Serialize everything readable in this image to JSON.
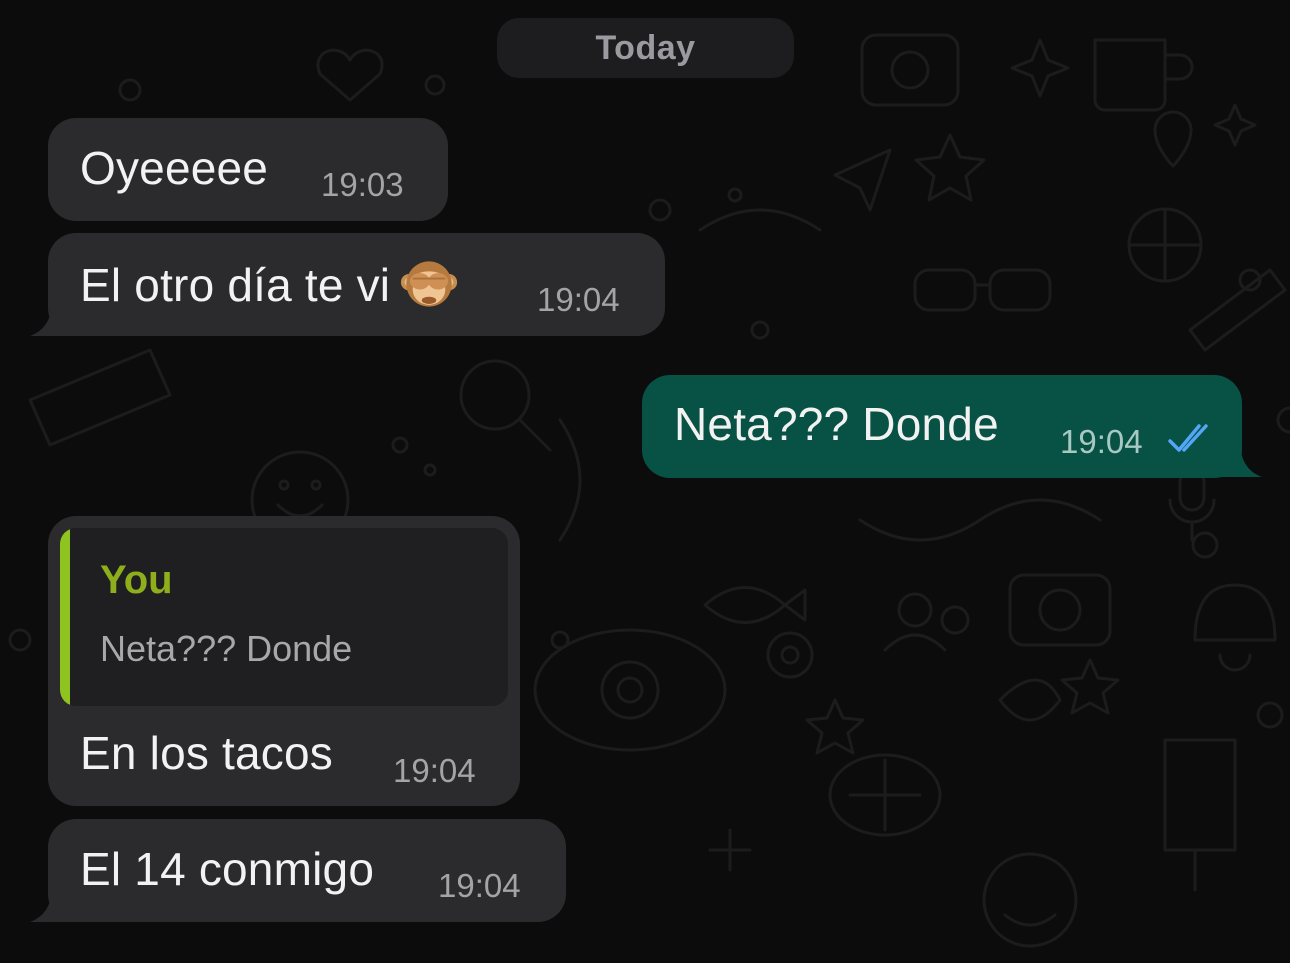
{
  "date_separator": "Today",
  "messages": [
    {
      "direction": "incoming",
      "text": "Oyeeeee",
      "time": "19:03"
    },
    {
      "direction": "incoming",
      "text": "El otro día te vi",
      "emoji": "see-no-evil-monkey",
      "time": "19:04"
    },
    {
      "direction": "outgoing",
      "text": "Neta??? Donde",
      "time": "19:04",
      "status": "read"
    },
    {
      "direction": "incoming",
      "reply_to": {
        "author": "You",
        "text": "Neta??? Donde"
      },
      "text": "En los tacos",
      "time": "19:04"
    },
    {
      "direction": "incoming",
      "text": "El 14 conmigo",
      "time": "19:04"
    }
  ],
  "colors": {
    "background": "#0c0c0c",
    "incoming_bubble": "#2b2b2e",
    "outgoing_bubble": "#075145",
    "read_ticks": "#53a6f5",
    "quote_accent": "#8fc31f"
  },
  "icons": [
    "double-check-icon",
    "see-no-evil-monkey-emoji",
    "chat-wallpaper-doodles"
  ]
}
